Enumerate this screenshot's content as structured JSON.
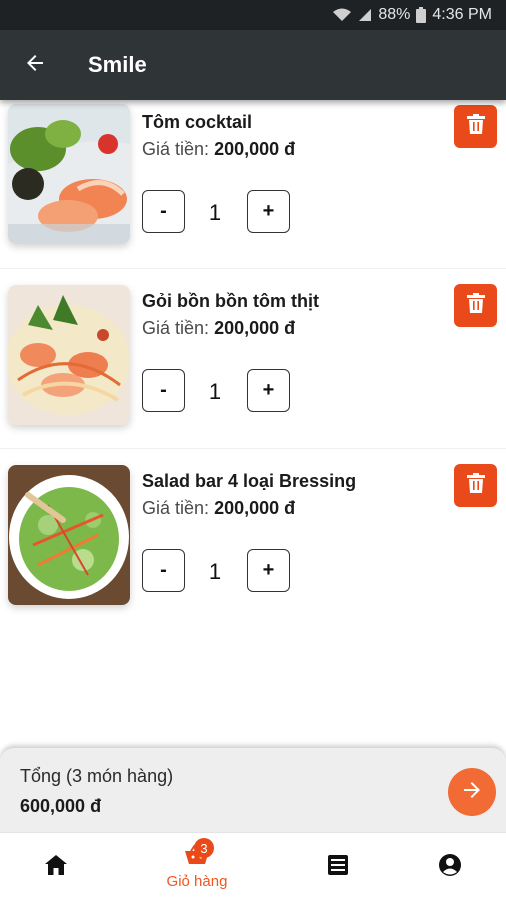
{
  "status_bar": {
    "battery": "88%",
    "time": "4:36 PM"
  },
  "app_bar": {
    "title": "Smile"
  },
  "cart": {
    "items": [
      {
        "name": "Tôm cocktail",
        "price_label": "Giá tiền:",
        "price": "200,000 đ",
        "minus": "-",
        "qty": "1",
        "plus": "+"
      },
      {
        "name": "Gỏi bồn bồn tôm thịt",
        "price_label": "Giá tiền:",
        "price": "200,000 đ",
        "minus": "-",
        "qty": "1",
        "plus": "+"
      },
      {
        "name": "Salad bar 4 loại Bressing",
        "price_label": "Giá tiền:",
        "price": "200,000 đ",
        "minus": "-",
        "qty": "1",
        "plus": "+"
      }
    ]
  },
  "summary": {
    "label": "Tổng (3 món hàng)",
    "total": "600,000 đ"
  },
  "bottom_nav": {
    "cart_label": "Giỏ hàng",
    "cart_badge": "3",
    "items": [
      "home-icon",
      "cart-icon",
      "list-icon",
      "account-icon"
    ]
  },
  "colors": {
    "accent": "#ea4a19",
    "checkout": "#f26a34",
    "app_bar": "#2f3437",
    "status_bar": "#1f2224"
  }
}
